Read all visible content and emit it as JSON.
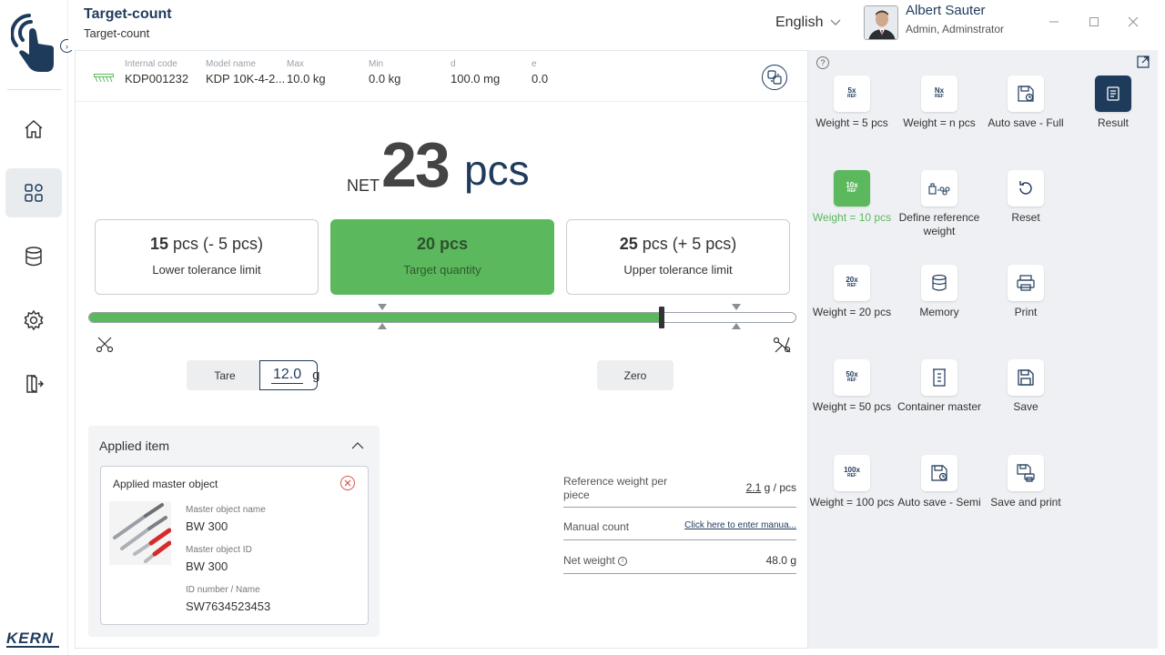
{
  "header": {
    "title": "Target-count",
    "subtitle": "Target-count",
    "language": "English",
    "user_name": "Albert Sauter",
    "user_role": "Admin, Adminstrator"
  },
  "sidebar": {
    "brand": "KERN",
    "items": [
      {
        "name": "home",
        "icon": "home-icon"
      },
      {
        "name": "apps",
        "icon": "grid-icon",
        "active": true
      },
      {
        "name": "database",
        "icon": "database-icon"
      },
      {
        "name": "settings",
        "icon": "gear-icon"
      },
      {
        "name": "logout",
        "icon": "exit-icon"
      }
    ]
  },
  "info_bar": {
    "internal_code_label": "Internal code",
    "internal_code": "KDP001232",
    "model_name_label": "Model name",
    "model_name": "KDP 10K-4-2...",
    "max_label": "Max",
    "max": "10.0 kg",
    "min_label": "Min",
    "min": "0.0 kg",
    "d_label": "d",
    "d": "100.0 mg",
    "e_label": "e",
    "e": "0.0"
  },
  "display": {
    "net_label": "NET",
    "value": "23",
    "unit": "pcs"
  },
  "tolerance": {
    "lower_value": "15",
    "lower_suffix": " pcs (- 5 pcs)",
    "lower_label": "Lower tolerance limit",
    "target_value": "20 pcs",
    "target_label": "Target quantity",
    "upper_value": "25",
    "upper_suffix": " pcs (+ 5 pcs)",
    "upper_label": "Upper tolerance limit"
  },
  "progress": {
    "fill_fraction": 0.81,
    "lower_fraction": 0.415,
    "upper_fraction": 0.915
  },
  "controls": {
    "tare_label": "Tare",
    "tare_value": "12.0",
    "tare_unit": "g",
    "zero_label": "Zero"
  },
  "applied_item": {
    "title": "Applied item",
    "card_title": "Applied master object",
    "master_name_label": "Master object name",
    "master_name": "BW 300",
    "master_id_label": "Master object ID",
    "master_id": "BW 300",
    "id_number_label": "ID number / Name",
    "id_number": "SW7634523453"
  },
  "reference": {
    "ref_weight_label": "Reference weight per piece",
    "ref_weight_value": "2.1",
    "ref_weight_unit": "g / pcs",
    "manual_count_label": "Manual count",
    "manual_count_link": "Click here to enter manua...",
    "net_weight_label": "Net weight",
    "net_weight_value": "48.0",
    "net_weight_unit": "g"
  },
  "functions": [
    {
      "label": "Weight = 5 pcs",
      "icon": "5x"
    },
    {
      "label": "Weight = n pcs",
      "icon": "Nx"
    },
    {
      "label": "Auto save - Full",
      "icon": "auto-save-icon"
    },
    {
      "label": "Result",
      "icon": "result-icon"
    },
    {
      "label": "Weight = 10 pcs",
      "icon": "10x"
    },
    {
      "label": "Define reference weight",
      "icon": "define-reference-icon"
    },
    {
      "label": "Reset",
      "icon": "reset-icon"
    },
    {
      "label": "Weight = 20 pcs",
      "icon": "20x"
    },
    {
      "label": "Memory",
      "icon": "memory-icon"
    },
    {
      "label": "Print",
      "icon": "print-icon"
    },
    {
      "label": "Weight = 50 pcs",
      "icon": "50x"
    },
    {
      "label": "Container master",
      "icon": "container-icon"
    },
    {
      "label": "Save",
      "icon": "save-icon"
    },
    {
      "label": "Weight = 100 pcs",
      "icon": "100x"
    },
    {
      "label": "Auto save - Semi",
      "icon": "auto-save-semi-icon"
    },
    {
      "label": "Save and print",
      "icon": "save-print-icon"
    }
  ],
  "icon_ref_text": "REF",
  "colors": {
    "accent": "#1f3b5c",
    "success": "#5cb85c",
    "danger": "#d9534f"
  }
}
